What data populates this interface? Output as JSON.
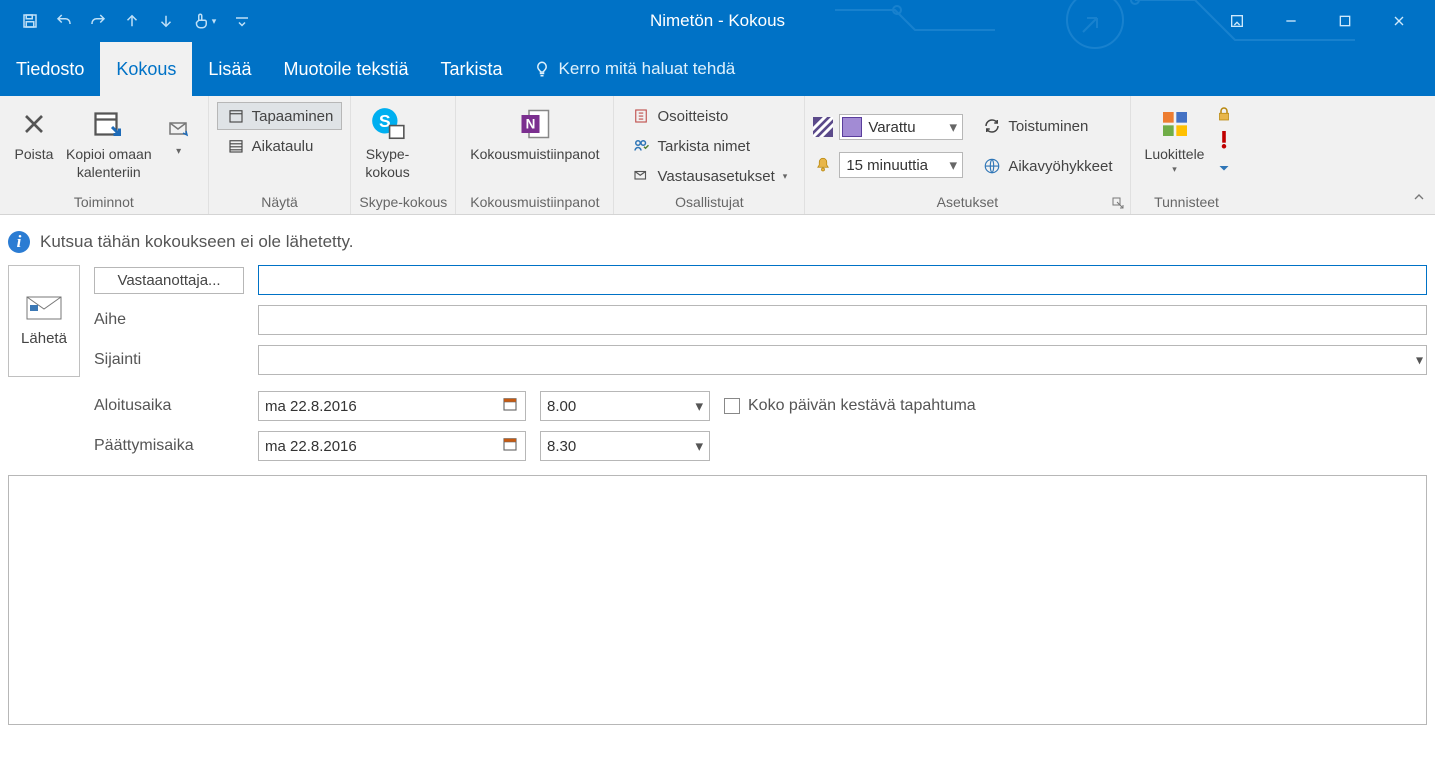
{
  "window": {
    "title": "Nimetön - Kokous"
  },
  "tabs": {
    "file": "Tiedosto",
    "meeting": "Kokous",
    "insert": "Lisää",
    "format": "Muotoile tekstiä",
    "review": "Tarkista",
    "tellme": "Kerro mitä haluat tehdä"
  },
  "ribbon": {
    "actions": {
      "delete": "Poista",
      "copy_to_calendar": "Kopioi omaan\nkalenteriin",
      "group": "Toiminnot"
    },
    "show": {
      "appointment": "Tapaaminen",
      "scheduling": "Aikataulu",
      "group": "Näytä"
    },
    "skype": {
      "button": "Skype-\nkokous",
      "group": "Skype-kokous"
    },
    "notes": {
      "button": "Kokousmuistiinpanot",
      "group": "Kokousmuistiinpanot"
    },
    "attendees": {
      "address_book": "Osoitteisto",
      "check_names": "Tarkista nimet",
      "response_options": "Vastausasetukset",
      "group": "Osallistujat"
    },
    "options": {
      "show_as": "Varattu",
      "reminder": "15 minuuttia",
      "recurrence": "Toistuminen",
      "time_zones": "Aikavyöhykkeet",
      "group": "Asetukset"
    },
    "tags": {
      "categorize": "Luokittele",
      "group": "Tunnisteet"
    }
  },
  "infobar": "Kutsua tähän kokoukseen ei ole lähetetty.",
  "form": {
    "send": "Lähetä",
    "to_button": "Vastaanottaja...",
    "to_value": "",
    "subject_label": "Aihe",
    "subject_value": "",
    "location_label": "Sijainti",
    "location_value": "",
    "start_label": "Aloitusaika",
    "start_date": "ma 22.8.2016",
    "start_time": "8.00",
    "end_label": "Päättymisaika",
    "end_date": "ma 22.8.2016",
    "end_time": "8.30",
    "all_day": "Koko päivän kestävä tapahtuma"
  }
}
